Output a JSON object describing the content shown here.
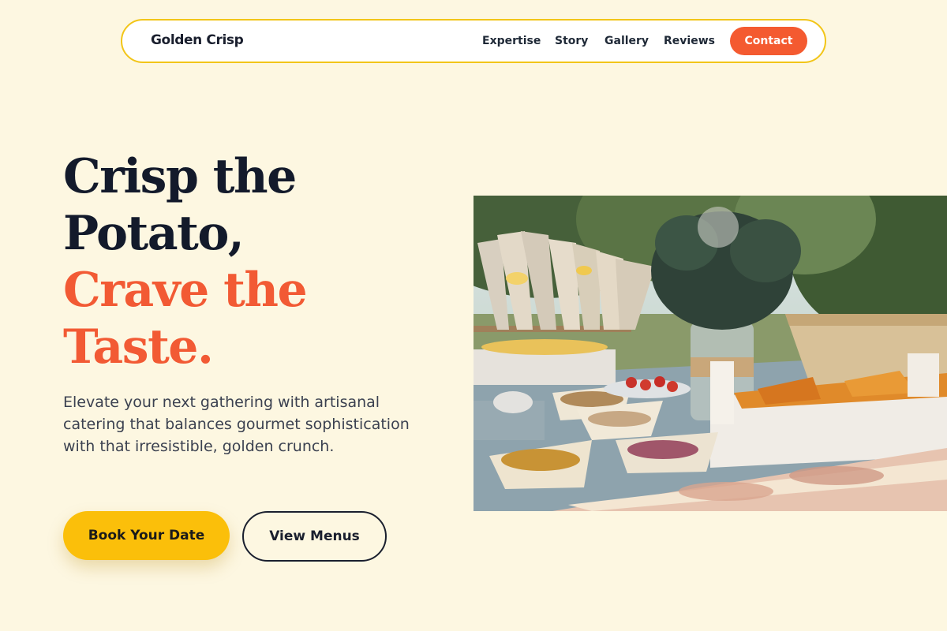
{
  "nav": {
    "brand": "Golden Crisp",
    "links": [
      "Expertise",
      "Story",
      "Gallery",
      "Reviews"
    ],
    "contact_label": "Contact"
  },
  "hero": {
    "headline_lines": [
      "Crisp the",
      "Potato,"
    ],
    "headline_accent_lines": [
      "Crave the",
      "Taste."
    ],
    "description": "Elevate your next gathering with artisanal catering that balances gourmet sophistication with that irresistible, golden crunch.",
    "primary_cta": "Book Your Date",
    "secondary_cta": "View Menus"
  },
  "colors": {
    "background": "#fdf7e1",
    "nav_border": "#f2c518",
    "accent_orange": "#f25a34",
    "primary_button": "#fbbf0a",
    "dark_text": "#131a2b"
  }
}
